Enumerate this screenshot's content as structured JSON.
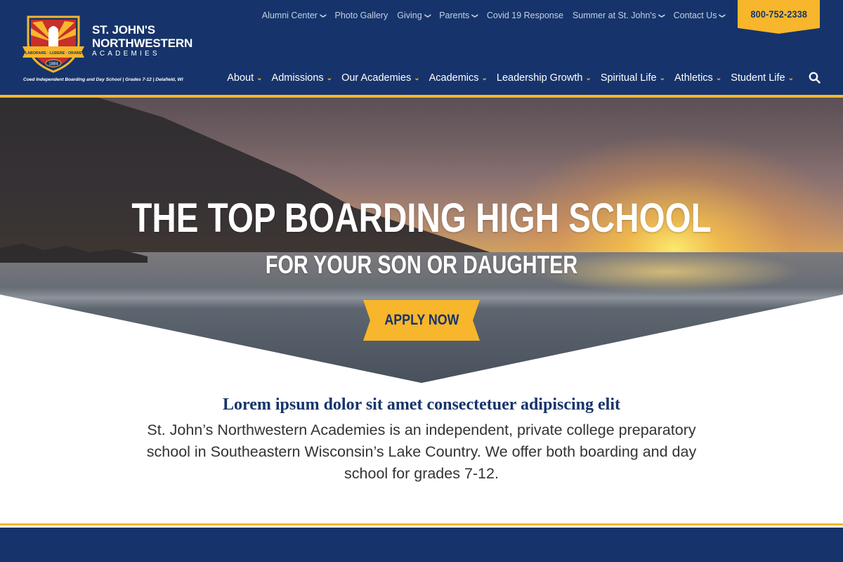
{
  "brand": {
    "name_line1": "ST. JOHN'S",
    "name_line2": "NORTHWESTERN",
    "name_sub": "ACADEMIES",
    "tagline": "Coed Independent Boarding and Day School | Grades 7-12 | Delafield, WI",
    "crest_banner": "LABORARE · LUDERE · ORARE",
    "crest_year": "1884"
  },
  "utility_nav": [
    {
      "label": "Alumni Center",
      "has_dropdown": true
    },
    {
      "label": "Photo Gallery",
      "has_dropdown": false
    },
    {
      "label": "Giving",
      "has_dropdown": true
    },
    {
      "label": "Parents",
      "has_dropdown": true
    },
    {
      "label": "Covid 19 Response",
      "has_dropdown": false
    },
    {
      "label": "Summer at St. John's",
      "has_dropdown": true
    },
    {
      "label": "Contact Us",
      "has_dropdown": true
    }
  ],
  "phone": "800-752-2338",
  "main_nav": [
    {
      "label": "About",
      "has_dropdown": true
    },
    {
      "label": "Admissions",
      "has_dropdown": true
    },
    {
      "label": "Our Academies",
      "has_dropdown": true
    },
    {
      "label": "Academics",
      "has_dropdown": true
    },
    {
      "label": "Leadership Growth",
      "has_dropdown": true
    },
    {
      "label": "Spiritual Life",
      "has_dropdown": true
    },
    {
      "label": "Athletics",
      "has_dropdown": true
    },
    {
      "label": "Student Life",
      "has_dropdown": true
    }
  ],
  "search_icon": "search-icon",
  "hero": {
    "title": "THE TOP BOARDING HIGH SCHOOL",
    "subtitle": "FOR YOUR SON OR DAUGHTER",
    "cta": "APPLY NOW"
  },
  "intro": {
    "heading": "Lorem ipsum dolor sit amet consectetuer adipiscing elit",
    "body": "St. John’s Northwestern Academies is an independent, private college preparatory school in Southeastern Wisconsin’s Lake Country. We offer both boarding and day school for grades 7-12."
  },
  "colors": {
    "navy": "#16346b",
    "gold": "#f7b62c",
    "body_text": "#333333",
    "utility_text": "#c4d0e4"
  }
}
